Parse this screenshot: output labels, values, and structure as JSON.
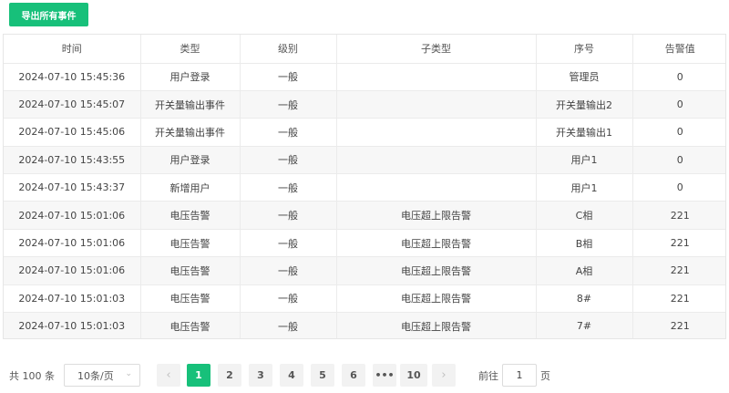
{
  "toolbar": {
    "export_label": "导出所有事件"
  },
  "table": {
    "columns": [
      "时间",
      "类型",
      "级别",
      "子类型",
      "序号",
      "告警值"
    ],
    "rows": [
      [
        "2024-07-10 15:45:36",
        "用户登录",
        "一般",
        "",
        "管理员",
        "0"
      ],
      [
        "2024-07-10 15:45:07",
        "开关量输出事件",
        "一般",
        "",
        "开关量输出2",
        "0"
      ],
      [
        "2024-07-10 15:45:06",
        "开关量输出事件",
        "一般",
        "",
        "开关量输出1",
        "0"
      ],
      [
        "2024-07-10 15:43:55",
        "用户登录",
        "一般",
        "",
        "用户1",
        "0"
      ],
      [
        "2024-07-10 15:43:37",
        "新增用户",
        "一般",
        "",
        "用户1",
        "0"
      ],
      [
        "2024-07-10 15:01:06",
        "电压告警",
        "一般",
        "电压超上限告警",
        "C相",
        "221"
      ],
      [
        "2024-07-10 15:01:06",
        "电压告警",
        "一般",
        "电压超上限告警",
        "B相",
        "221"
      ],
      [
        "2024-07-10 15:01:06",
        "电压告警",
        "一般",
        "电压超上限告警",
        "A相",
        "221"
      ],
      [
        "2024-07-10 15:01:03",
        "电压告警",
        "一般",
        "电压超上限告警",
        "8#",
        "221"
      ],
      [
        "2024-07-10 15:01:03",
        "电压告警",
        "一般",
        "电压超上限告警",
        "7#",
        "221"
      ]
    ]
  },
  "pagination": {
    "total_label": "共 100 条",
    "page_size": "10条/页",
    "prev_icon": "chevron-left-icon",
    "next_icon": "chevron-right-icon",
    "pages": [
      "1",
      "2",
      "3",
      "4",
      "5",
      "6",
      "•••",
      "10"
    ],
    "current_page": "1",
    "goto_label": "前往",
    "goto_value": "1",
    "goto_suffix": "页"
  },
  "colors": {
    "accent": "#17c07a",
    "row_stripe": "#f7f7f7",
    "border": "#ebebeb"
  }
}
